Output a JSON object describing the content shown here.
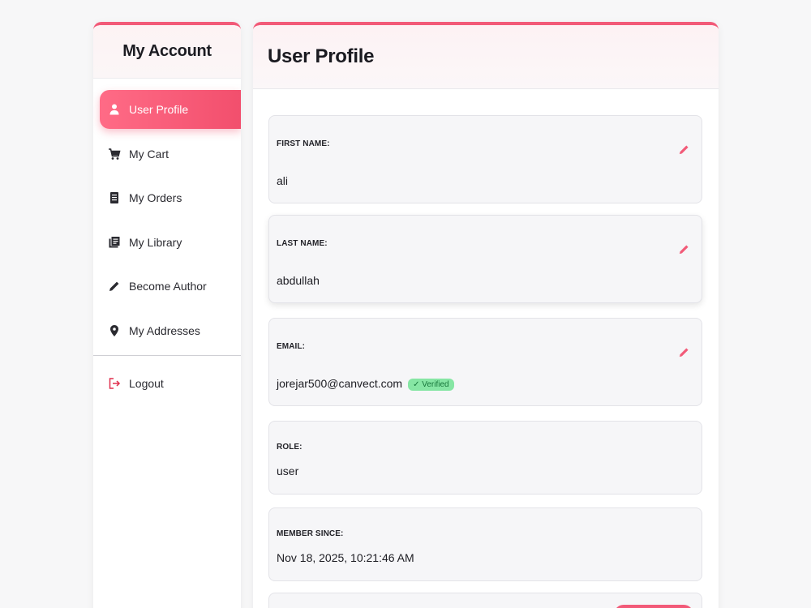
{
  "sidebar": {
    "title": "My Account",
    "items": [
      {
        "label": "User Profile",
        "icon": "user-icon",
        "active": true
      },
      {
        "label": "My Cart",
        "icon": "cart-icon"
      },
      {
        "label": "My Orders",
        "icon": "orders-icon"
      },
      {
        "label": "My Library",
        "icon": "library-icon"
      },
      {
        "label": "Become Author",
        "icon": "pencil-icon"
      },
      {
        "label": "My Addresses",
        "icon": "location-icon"
      }
    ],
    "logout": {
      "label": "Logout",
      "icon": "logout-icon"
    }
  },
  "main": {
    "title": "User Profile",
    "fields": {
      "first_name": {
        "label": "FIRST NAME:",
        "value": "ali"
      },
      "last_name": {
        "label": "LAST NAME:",
        "value": "abdullah"
      },
      "email": {
        "label": "EMAIL:",
        "value": "jorejar500@canvect.com",
        "badge": "✓ Verified"
      },
      "role": {
        "label": "ROLE:",
        "value": "user"
      },
      "member_since": {
        "label": "MEMBER SINCE:",
        "value": "Nov 18, 2025, 10:21:46 AM"
      }
    }
  },
  "colors": {
    "accent": "#f25a78",
    "verified_bg": "#86e6a4",
    "verified_text": "#16763a",
    "logout_icon": "#e0314f"
  }
}
